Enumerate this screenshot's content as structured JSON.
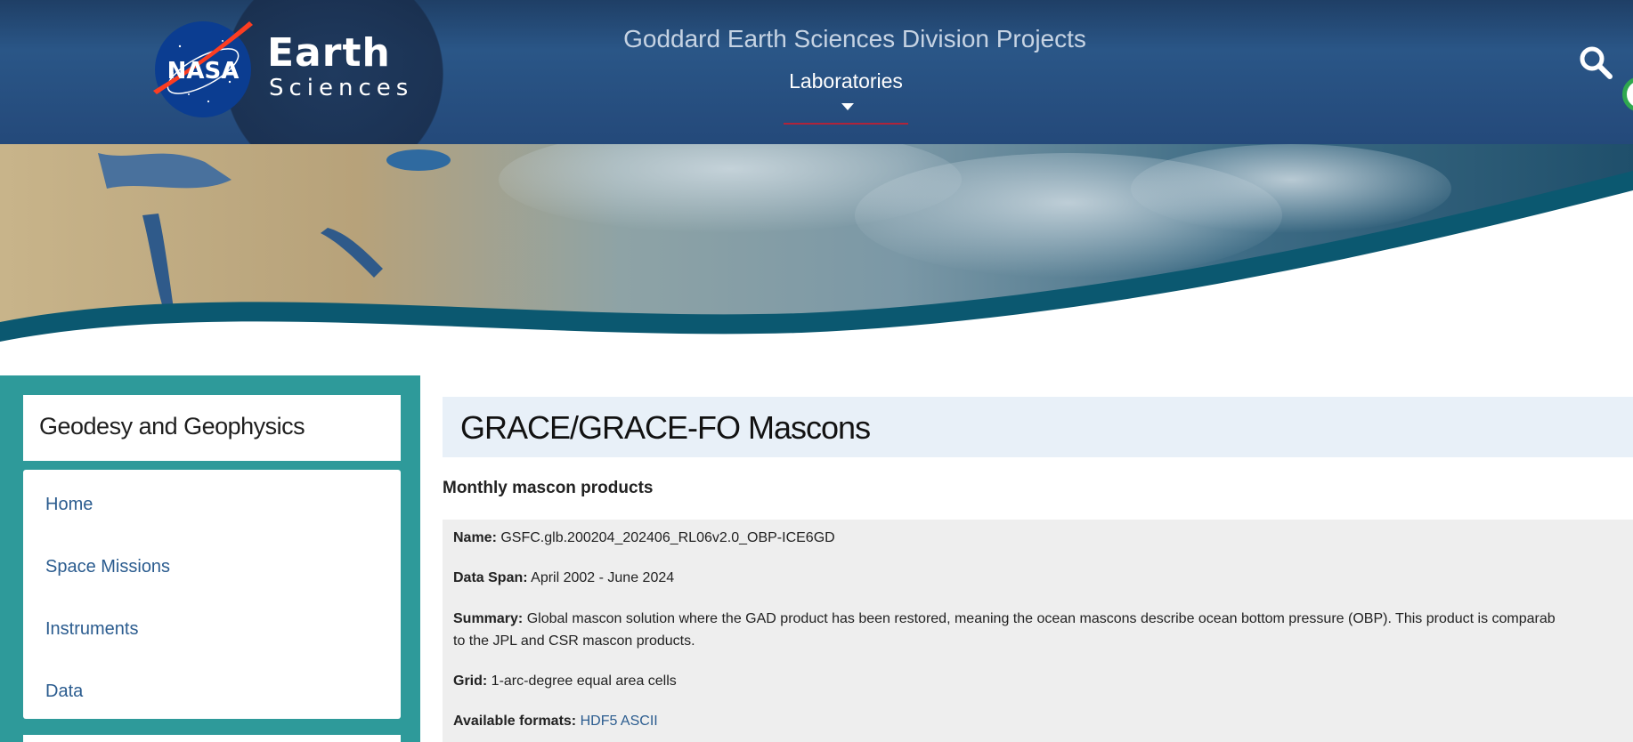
{
  "header": {
    "logo_earth": "Earth",
    "logo_sciences": "Sciences",
    "logo_nasa": "NASA",
    "site_title": "Goddard Earth Sciences Division Projects",
    "nav_laboratories": "Laboratories",
    "search_icon": "search-icon"
  },
  "sidebar": {
    "title": "Geodesy and Geophysics",
    "items": [
      {
        "label": "Home"
      },
      {
        "label": "Space Missions"
      },
      {
        "label": "Instruments"
      },
      {
        "label": "Data"
      }
    ]
  },
  "main": {
    "title": "GRACE/GRACE-FO Mascons",
    "subtitle": "Monthly mascon products",
    "product": {
      "name_label": "Name:",
      "name_value": "GSFC.glb.200204_202406_RL06v2.0_OBP-ICE6GD",
      "span_label": "Data Span:",
      "span_value": "April 2002 - June 2024",
      "summary_label": "Summary:",
      "summary_line1": "Global mascon solution where the GAD product has been restored, meaning the ocean mascons describe ocean bottom pressure (OBP). This product is comparab",
      "summary_line2": "to the JPL and CSR mascon products.",
      "grid_label": "Grid:",
      "grid_value": "1-arc-degree equal area cells",
      "formats_label": "Available formats:",
      "formats": [
        "HDF5",
        "ASCII"
      ]
    }
  },
  "colors": {
    "header_bg": "#24497a",
    "sidebar_bg": "#2e9a9a",
    "link": "#2b5c8f",
    "title_box": "#e8f0f8",
    "product_box": "#eeeeee",
    "nav_underline": "#b0243a"
  }
}
